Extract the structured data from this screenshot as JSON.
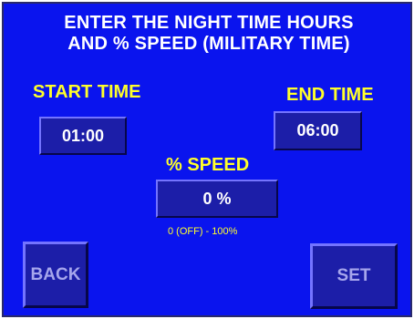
{
  "header": {
    "line1": "ENTER THE NIGHT TIME HOURS",
    "line2": "AND % SPEED (MILITARY TIME)"
  },
  "start_time": {
    "label": "START TIME",
    "value": "01:00"
  },
  "end_time": {
    "label": "END TIME",
    "value": "06:00"
  },
  "speed": {
    "label": "% SPEED",
    "value": "0 %",
    "range_hint": "0 (OFF) - 100%"
  },
  "buttons": {
    "back": "BACK",
    "set": "SET"
  },
  "colors": {
    "background": "#0a14ee",
    "label_text": "#ffff2a",
    "field_fill": "#1c1ea8",
    "button_text": "#a6a6ec"
  }
}
